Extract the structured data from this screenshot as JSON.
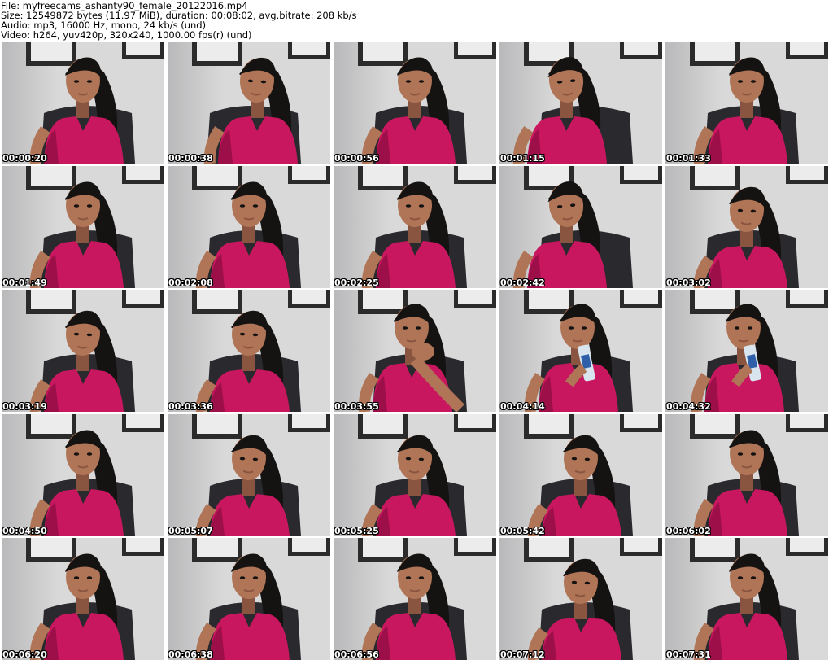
{
  "header": {
    "file_line": "File: myfreecams_ashanty90_female_20122016.mp4",
    "size_line": "Size: 12549872 bytes (11.97 MiB), duration: 00:08:02, avg.bitrate: 208 kb/s",
    "audio_line": "Audio: mp3, 16000 Hz, mono, 24 kb/s (und)",
    "video_line": "Video: h264, yuv420p, 320x240, 1000.00 fps(r) (und)"
  },
  "frames": [
    {
      "timestamp": "00:00:20",
      "pose": "center"
    },
    {
      "timestamp": "00:00:38",
      "pose": "right"
    },
    {
      "timestamp": "00:00:56",
      "pose": "center"
    },
    {
      "timestamp": "00:01:15",
      "pose": "left"
    },
    {
      "timestamp": "00:01:33",
      "pose": "center"
    },
    {
      "timestamp": "00:01:49",
      "pose": "center"
    },
    {
      "timestamp": "00:02:08",
      "pose": "center"
    },
    {
      "timestamp": "00:02:25",
      "pose": "center"
    },
    {
      "timestamp": "00:02:42",
      "pose": "left"
    },
    {
      "timestamp": "00:03:02",
      "pose": "down"
    },
    {
      "timestamp": "00:03:19",
      "pose": "down"
    },
    {
      "timestamp": "00:03:36",
      "pose": "down"
    },
    {
      "timestamp": "00:03:55",
      "pose": "hand"
    },
    {
      "timestamp": "00:04:14",
      "pose": "drink"
    },
    {
      "timestamp": "00:04:32",
      "pose": "drink"
    },
    {
      "timestamp": "00:04:50",
      "pose": "center"
    },
    {
      "timestamp": "00:05:07",
      "pose": "down"
    },
    {
      "timestamp": "00:05:25",
      "pose": "down"
    },
    {
      "timestamp": "00:05:42",
      "pose": "down"
    },
    {
      "timestamp": "00:06:02",
      "pose": "center"
    },
    {
      "timestamp": "00:06:20",
      "pose": "center"
    },
    {
      "timestamp": "00:06:38",
      "pose": "center"
    },
    {
      "timestamp": "00:06:56",
      "pose": "center"
    },
    {
      "timestamp": "00:07:12",
      "pose": "down"
    },
    {
      "timestamp": "00:07:31",
      "pose": "center"
    }
  ],
  "colors": {
    "wall": "#d9d9d9",
    "wall_shadow": "#b9b9bb",
    "frame_dark": "#2b2b2b",
    "frame_glass": "#ececec",
    "hair": "#151212",
    "skin": "#b07556",
    "skin_shadow": "#8a5540",
    "shirt": "#c8165f",
    "shirt_shadow": "#9c0f48",
    "chair": "#2a2a2e",
    "bottle": "#d8e4ee",
    "bottle_label": "#2f5fa8"
  }
}
